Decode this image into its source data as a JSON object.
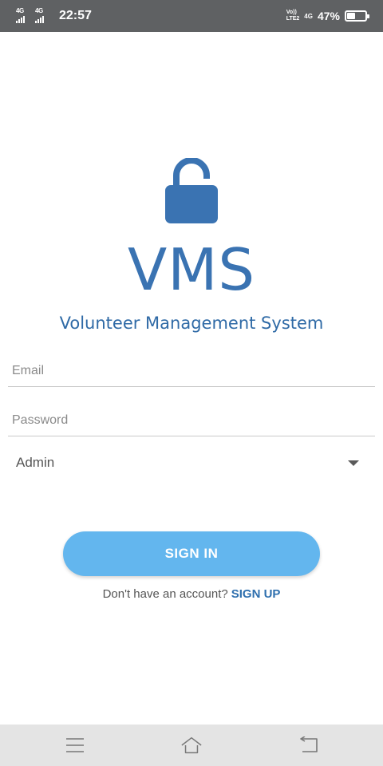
{
  "status_bar": {
    "sim1_network": "4G",
    "sim2_network": "4G",
    "time": "22:57",
    "volte_line1": "Vo))",
    "volte_line2": "LTE2",
    "data_network": "4G",
    "battery_percent_text": "47%",
    "battery_level": 0.47
  },
  "app": {
    "title": "VMS",
    "subtitle": "Volunteer Management System"
  },
  "form": {
    "email_placeholder": "Email",
    "email_value": "",
    "password_placeholder": "Password",
    "password_value": "",
    "role_selected": "Admin"
  },
  "actions": {
    "sign_in_label": "SIGN IN",
    "signup_prompt": "Don't have an account?",
    "signup_link": "SIGN UP"
  },
  "icons": {
    "lock": "lock-icon",
    "dropdown": "chevron-down-icon",
    "nav_menu": "menu-icon",
    "nav_home": "home-icon",
    "nav_back": "back-icon"
  },
  "colors": {
    "brand": "#3a73b2",
    "button": "#63b6ee",
    "status_bar": "#5f6163",
    "nav_bar": "#e4e4e4"
  }
}
